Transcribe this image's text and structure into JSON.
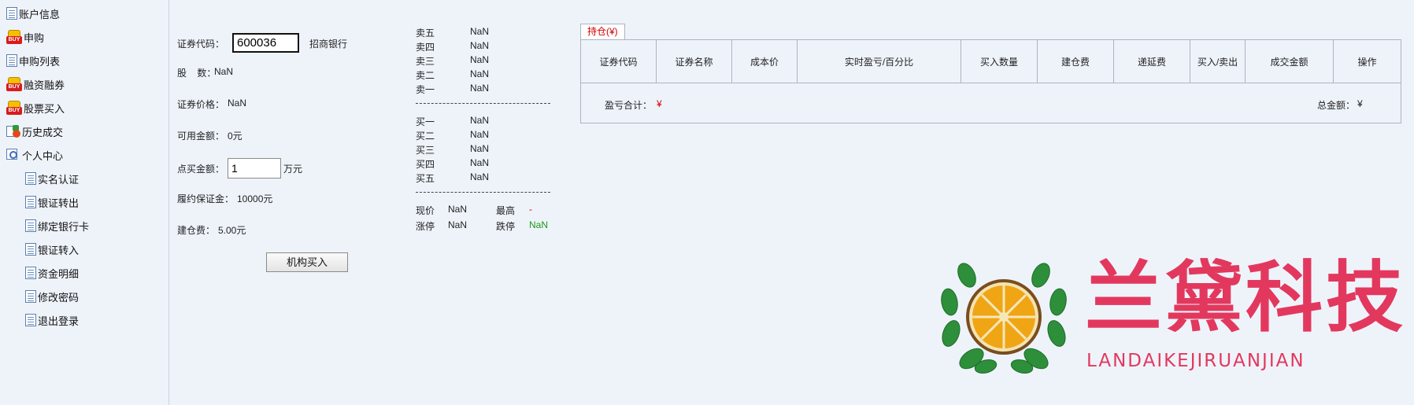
{
  "sidebar": {
    "items": [
      {
        "label": "账户信息",
        "icon": "document-icon"
      },
      {
        "label": "申购",
        "icon": "buy-icon"
      },
      {
        "label": "申购列表",
        "icon": "document-icon"
      },
      {
        "label": "融资融券",
        "icon": "buy-icon"
      },
      {
        "label": "股票买入",
        "icon": "buy-icon"
      },
      {
        "label": "历史成交",
        "icon": "history-icon"
      },
      {
        "label": "个人中心",
        "icon": "user-center-icon"
      }
    ],
    "subitems": [
      {
        "label": "实名认证"
      },
      {
        "label": "银证转出"
      },
      {
        "label": "绑定银行卡"
      },
      {
        "label": "银证转入"
      },
      {
        "label": "资金明细"
      },
      {
        "label": "修改密码"
      },
      {
        "label": "退出登录"
      }
    ]
  },
  "form": {
    "code_label": "证券代码：",
    "code_value": "600036",
    "stock_name": "招商银行",
    "shares_label": "股    数：",
    "shares_value": "NaN",
    "price_label": "证券价格：",
    "price_value": "NaN",
    "available_label": "可用金额：",
    "available_value": "0元",
    "amount_label": "点买金额：",
    "amount_value": "1",
    "amount_unit": "万元",
    "margin_label": "履约保证金：",
    "margin_value": "10000元",
    "fee_label": "建仓费：",
    "fee_value": "5.00元",
    "submit_label": "机构买入"
  },
  "orderbook": {
    "sell": [
      {
        "label": "卖五",
        "value": "NaN"
      },
      {
        "label": "卖四",
        "value": "NaN"
      },
      {
        "label": "卖三",
        "value": "NaN"
      },
      {
        "label": "卖二",
        "value": "NaN"
      },
      {
        "label": "卖一",
        "value": "NaN"
      }
    ],
    "buy": [
      {
        "label": "买一",
        "value": "NaN"
      },
      {
        "label": "买二",
        "value": "NaN"
      },
      {
        "label": "买三",
        "value": "NaN"
      },
      {
        "label": "买四",
        "value": "NaN"
      },
      {
        "label": "买五",
        "value": "NaN"
      }
    ],
    "current_label": "现价",
    "current_value": "NaN",
    "high_label": "最高",
    "high_value": "-",
    "limit_up_label": "涨停",
    "limit_up_value": "NaN",
    "limit_down_label": "跌停",
    "limit_down_value": "NaN"
  },
  "holdings": {
    "tab_label": "持仓(¥)",
    "columns": [
      "证券代码",
      "证券名称",
      "成本价",
      "实时盈亏/百分比",
      "买入数量",
      "建仓费",
      "递延费",
      "买入/卖出",
      "成交金额",
      "操作"
    ],
    "pl_total_label": "盈亏合计：",
    "pl_total_value": "¥",
    "total_amount_label": "总金额：",
    "total_amount_value": "¥"
  },
  "logo": {
    "name_cn": "兰黛科技",
    "name_en": "LANDAIKEJIRUANJIAN"
  },
  "colors": {
    "background": "#eef3fa",
    "accent_red": "#d40000",
    "accent_green": "#1a9a1a",
    "logo_pink": "#e3385e",
    "border": "#aab4c1"
  }
}
